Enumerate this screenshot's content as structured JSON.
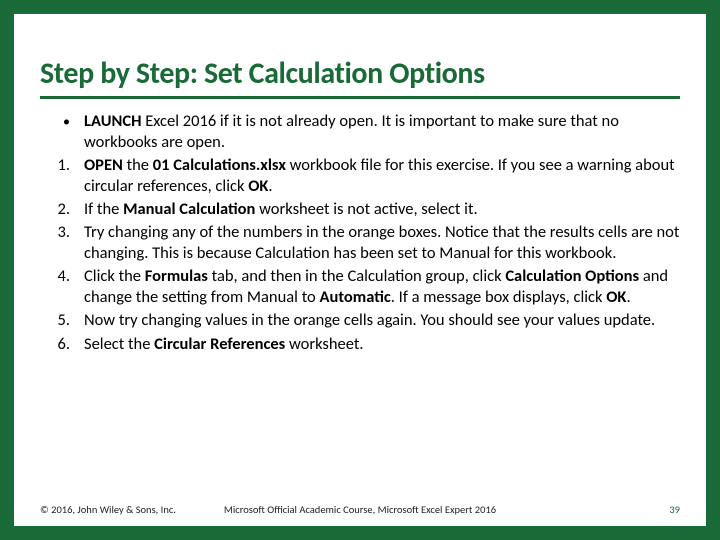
{
  "title": "Step by Step: Set Calculation Options",
  "bullet": {
    "marker": "•",
    "pre": "LAUNCH",
    "post": " Excel 2016 if it is not already open. It is important to make sure that no workbooks are open."
  },
  "steps": [
    {
      "num": "1.",
      "parts": [
        {
          "b": true,
          "t": "OPEN"
        },
        {
          "b": false,
          "t": " the "
        },
        {
          "b": true,
          "t": "01 Calculations.xlsx"
        },
        {
          "b": false,
          "t": " workbook file for this exercise. If you see a warning about circular references, click "
        },
        {
          "b": true,
          "t": "OK"
        },
        {
          "b": false,
          "t": "."
        }
      ]
    },
    {
      "num": "2.",
      "parts": [
        {
          "b": false,
          "t": "If the "
        },
        {
          "b": true,
          "t": "Manual Calculation"
        },
        {
          "b": false,
          "t": " worksheet is not active, select it."
        }
      ]
    },
    {
      "num": "3.",
      "parts": [
        {
          "b": false,
          "t": "Try changing any of the numbers in the orange boxes. Notice that the results cells are not changing. This is because Calculation has been set to Manual for this workbook."
        }
      ]
    },
    {
      "num": "4.",
      "parts": [
        {
          "b": false,
          "t": "Click the "
        },
        {
          "b": true,
          "t": "Formulas"
        },
        {
          "b": false,
          "t": " tab, and then in the Calculation group, click "
        },
        {
          "b": true,
          "t": "Calculation Options"
        },
        {
          "b": false,
          "t": " and change the setting from Manual to "
        },
        {
          "b": true,
          "t": "Automatic"
        },
        {
          "b": false,
          "t": ". If a message box displays, click "
        },
        {
          "b": true,
          "t": "OK"
        },
        {
          "b": false,
          "t": "."
        }
      ]
    },
    {
      "num": "5.",
      "parts": [
        {
          "b": false,
          "t": "Now try changing values in the orange cells again. You should see your values update."
        }
      ]
    },
    {
      "num": "6.",
      "parts": [
        {
          "b": false,
          "t": "Select the "
        },
        {
          "b": true,
          "t": "Circular References"
        },
        {
          "b": false,
          "t": " worksheet."
        }
      ]
    }
  ],
  "footer": {
    "left": "© 2016, John Wiley & Sons, Inc.",
    "center": "Microsoft Official Academic Course, Microsoft Excel Expert 2016",
    "page": "39"
  }
}
